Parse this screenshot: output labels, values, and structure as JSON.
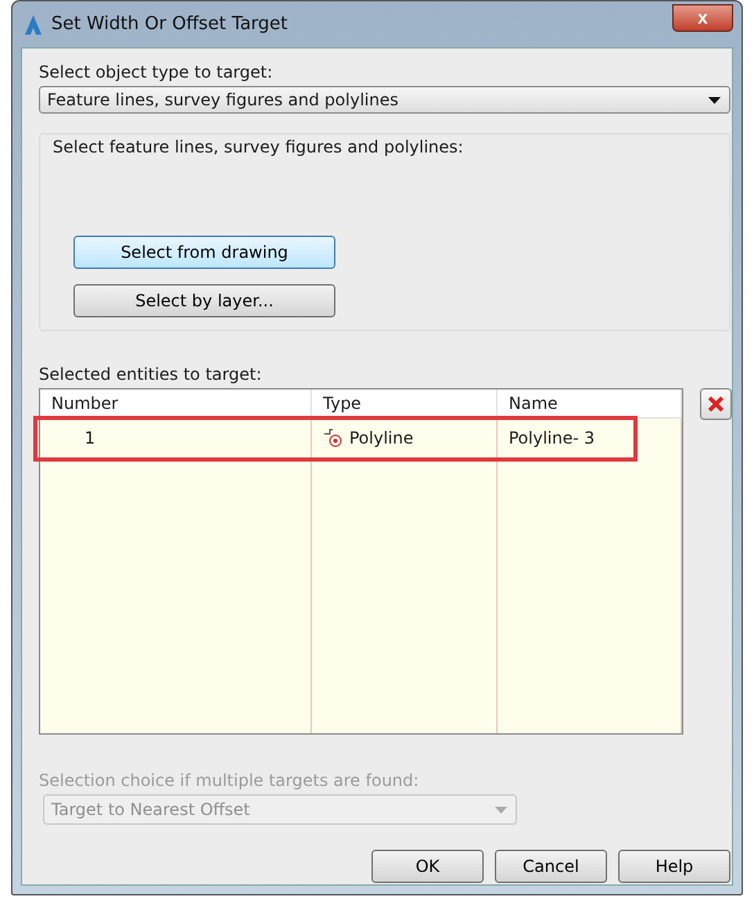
{
  "window": {
    "title": "Set Width Or Offset Target",
    "close": "x"
  },
  "object_type": {
    "label": "Select object type to target:",
    "value": "Feature lines, survey figures and polylines"
  },
  "selection_group": {
    "label": "Select feature lines, survey figures and polylines:",
    "buttons": [
      {
        "label": "Select from drawing",
        "focused": true
      },
      {
        "label": "Select by layer...",
        "focused": false
      }
    ]
  },
  "entities": {
    "label": "Selected entities to target:",
    "columns": [
      "Number",
      "Type",
      "Name"
    ],
    "rows": [
      {
        "number": "1",
        "type": "Polyline",
        "name": "Polyline- 3",
        "highlighted": true
      }
    ]
  },
  "selection_choice": {
    "label": "Selection choice if multiple targets are found:",
    "value": "Target to Nearest Offset",
    "disabled": true
  },
  "buttons": [
    "OK",
    "Cancel",
    "Help"
  ]
}
